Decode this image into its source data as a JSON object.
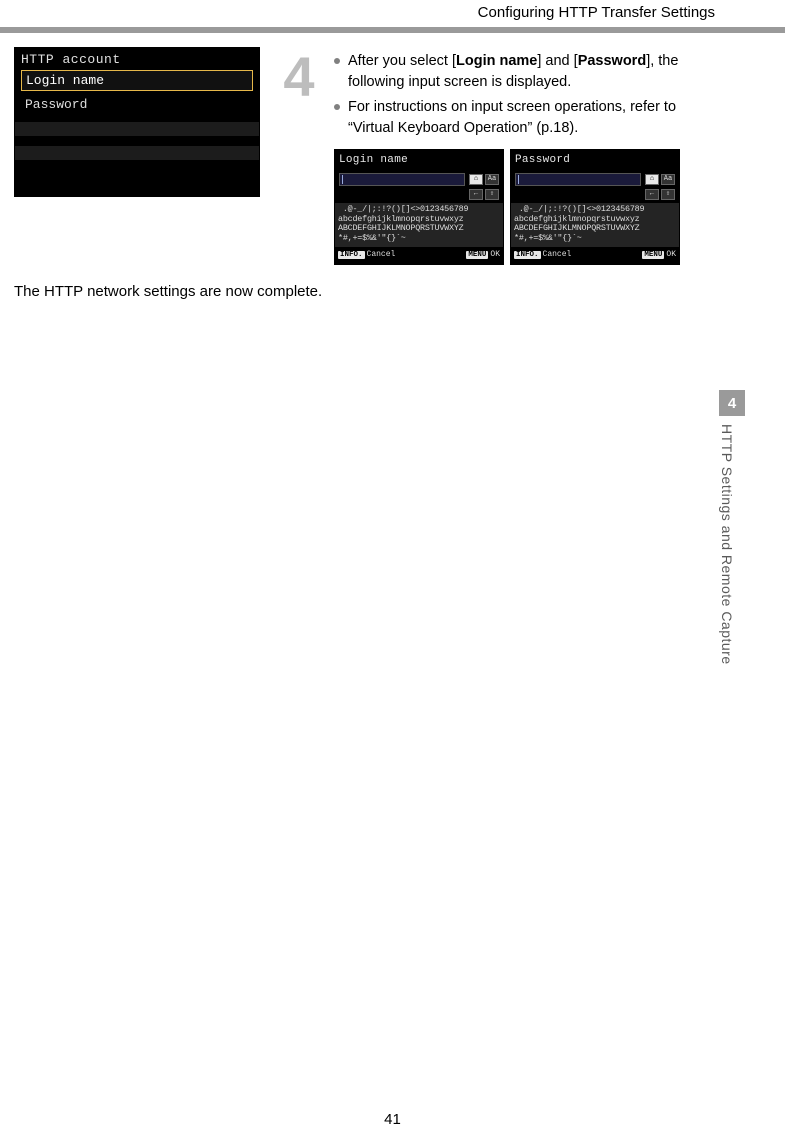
{
  "header": {
    "title": "Configuring HTTP Transfer Settings"
  },
  "step": {
    "number": "4"
  },
  "menu": {
    "title": "HTTP account",
    "items": [
      "Login name",
      "Password"
    ],
    "selected_index": 0
  },
  "bullets": {
    "b1_pre": "After you select [",
    "b1_bold1": "Login name",
    "b1_mid": "] and [",
    "b1_bold2": "Password",
    "b1_post": "], the following input screen is displayed.",
    "b2": "For instructions on input screen operations, refer to “Virtual Keyboard Operation” (p.18)."
  },
  "keyboards": [
    {
      "title": "Login name",
      "chars": [
        ".@-_/|;:!?()[]<>0123456789",
        "abcdefghijklmnopqrstuvwxyz",
        "ABCDEFGHIJKLMNOPQRSTUVWXYZ",
        "*#,+=$%&'\"{}`~"
      ],
      "footer_left_tag": "INFO.",
      "footer_left": "Cancel",
      "footer_right_tag": "MENU",
      "footer_right": "OK"
    },
    {
      "title": "Password",
      "chars": [
        ".@-_/|;:!?()[]<>0123456789",
        "abcdefghijklmnopqrstuvwxyz",
        "ABCDEFGHIJKLMNOPQRSTUVWXYZ",
        "*#,+=$%&'\"{}`~"
      ],
      "footer_left_tag": "INFO.",
      "footer_left": "Cancel",
      "footer_right_tag": "MENU",
      "footer_right": "OK"
    }
  ],
  "completion": "The HTTP network settings are now complete.",
  "side_tab": {
    "number": "4",
    "label": "HTTP Settings and Remote Capture"
  },
  "page_number": "41"
}
